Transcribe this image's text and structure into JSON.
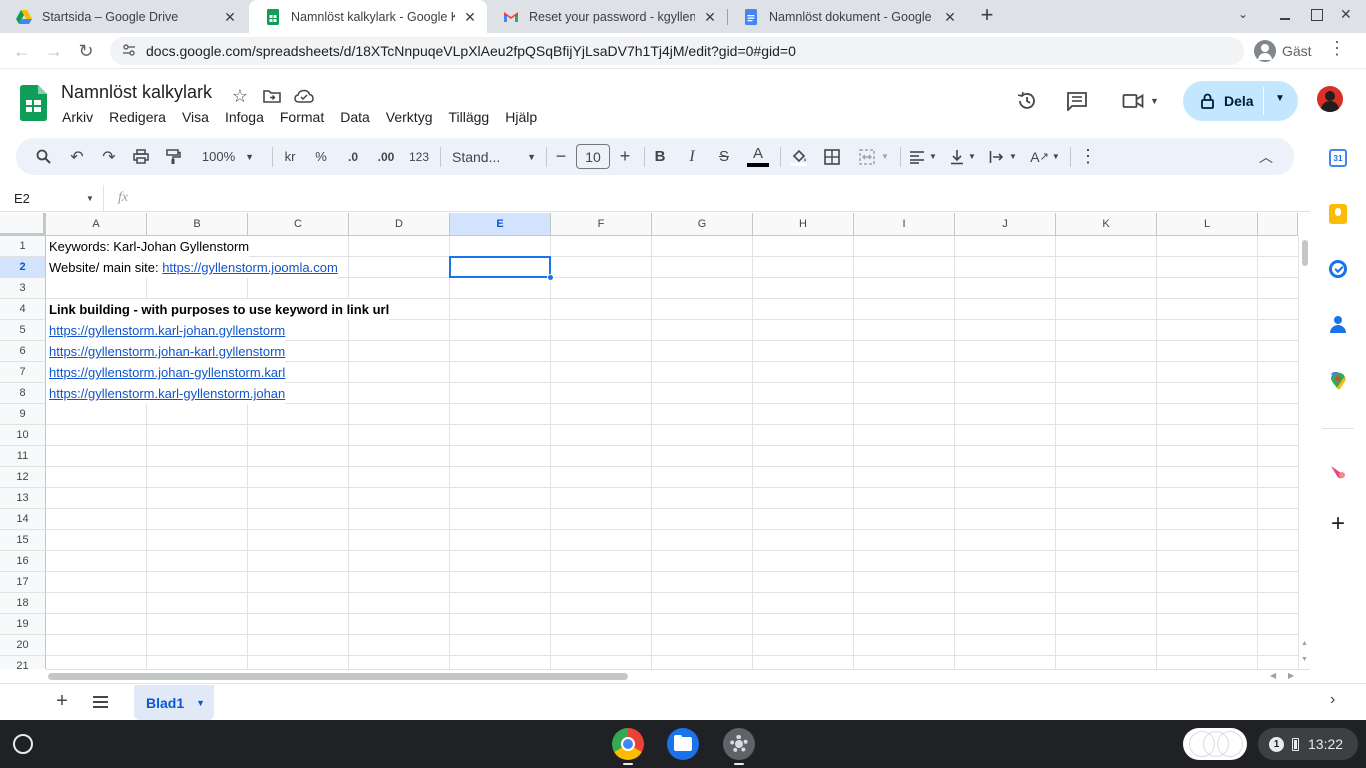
{
  "browser": {
    "tabs": [
      {
        "title": "Startsida – Google Drive",
        "favicon": "google-drive-icon",
        "active": false
      },
      {
        "title": "Namnlöst kalkylark - Google Kal",
        "favicon": "google-sheets-icon",
        "active": true
      },
      {
        "title": "Reset your password - kgyllensto",
        "favicon": "gmail-icon",
        "active": false
      },
      {
        "title": "Namnlöst dokument - Google Do",
        "favicon": "google-docs-icon",
        "active": false
      }
    ],
    "url": "docs.google.com/spreadsheets/d/18XTcNnpuqeVLpXlAeu2fpQSqBfijYjLsaDV7h1Tj4jM/edit?gid=0#gid=0",
    "profile_label": "Gäst"
  },
  "sheets": {
    "title": "Namnlöst kalkylark",
    "menu": [
      "Arkiv",
      "Redigera",
      "Visa",
      "Infoga",
      "Format",
      "Data",
      "Verktyg",
      "Tillägg",
      "Hjälp"
    ],
    "share_label": "Dela",
    "toolbar": {
      "zoom": "100%",
      "currency": "kr",
      "percent": "%",
      "dec_decrease": ".0",
      "dec_increase": ".00",
      "number_format": "123",
      "font": "Stand...",
      "font_size": "10"
    },
    "name_box": "E2",
    "fx": "fx",
    "columns": [
      "A",
      "B",
      "C",
      "D",
      "E",
      "F",
      "G",
      "H",
      "I",
      "J",
      "K",
      "L"
    ],
    "selected_column": "E",
    "rows": [
      "1",
      "2",
      "3",
      "4",
      "5",
      "6",
      "7",
      "8",
      "9",
      "10",
      "11",
      "12",
      "13",
      "14",
      "15",
      "16",
      "17",
      "18",
      "19",
      "20",
      "21"
    ],
    "selected_row": "2",
    "cells": {
      "a1": "Keywords: Karl-Johan Gyllenstorm",
      "a2_label": "Website/ main site: ",
      "a2_link": "https://gyllenstorm.joomla.com",
      "a4": "Link building - with purposes to use keyword in link url",
      "a5": "https://gyllenstorm.karl-johan.gyllenstorm",
      "a6": "https://gyllenstorm.johan-karl.gyllenstorm",
      "a7": "https://gyllenstorm.johan-gyllenstorm.karl",
      "a8": "https://gyllenstorm.karl-gyllenstorm.johan"
    },
    "sheet_tab": "Blad1"
  },
  "shelf": {
    "time": "13:22",
    "notification_count": "1"
  },
  "colors": {
    "accent": "#0b57d0",
    "share_bg": "#c2e7ff",
    "sheets_green": "#0f9d58",
    "link": "#1155cc"
  }
}
